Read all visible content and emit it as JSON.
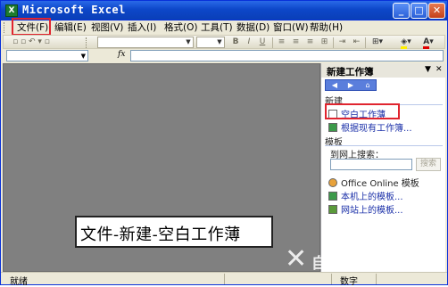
{
  "window": {
    "title": "Microsoft Excel"
  },
  "menu": {
    "items": [
      "文件(F)",
      "编辑(E)",
      "视图(V)",
      "插入(I)",
      "格式(O)",
      "工具(T)",
      "数据(D)",
      "窗口(W)",
      "帮助(H)"
    ]
  },
  "formula": {
    "fx_label": "fx"
  },
  "caption": {
    "text": "文件-新建-空白工作薄"
  },
  "taskpane": {
    "title": "新建工作簿",
    "section_new": "新建",
    "blank_workbook": "空白工作薄",
    "from_existing": "根据现有工作簿...",
    "section_templates": "模板",
    "search_label": "到网上搜索：",
    "search_button": "搜索",
    "office_online": "Office Online 模板",
    "local_templates": "本机上的模板...",
    "web_templates": "网站上的模板..."
  },
  "status": {
    "ready": "就绪",
    "num": "数字"
  },
  "watermark": {
    "text": "自由互联"
  },
  "colors": {
    "titlebar": "#0d47c9",
    "highlight": "#e0252f",
    "link": "#1a2fa8"
  }
}
